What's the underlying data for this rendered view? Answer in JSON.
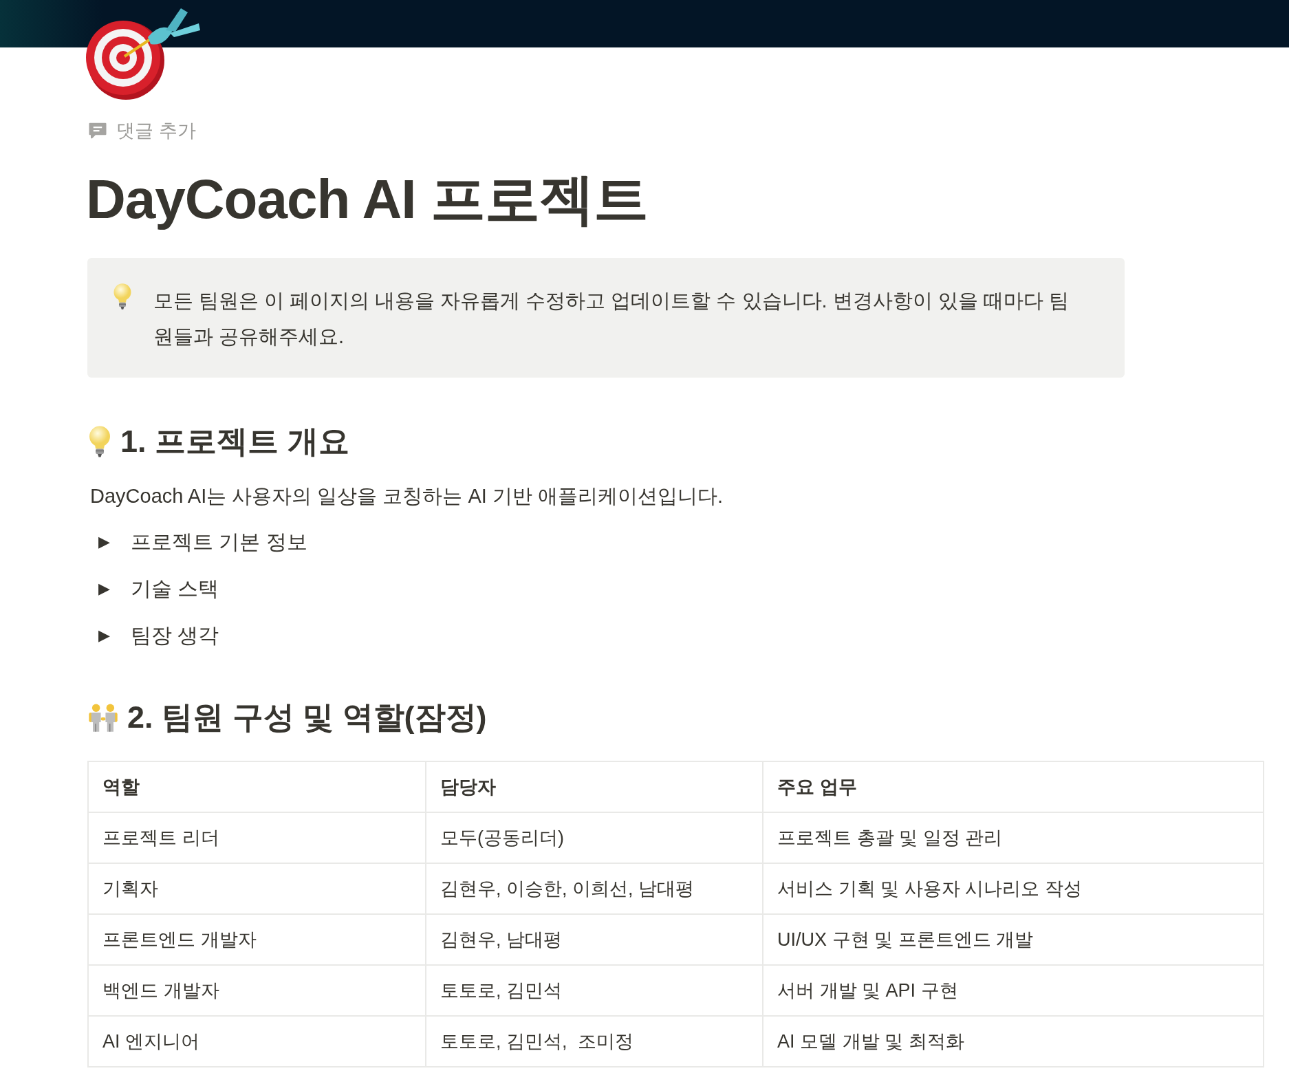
{
  "comment_button": {
    "label": "댓글 추가"
  },
  "title": "DayCoach AI 프로젝트",
  "callout": {
    "text": "모든 팀원은 이 페이지의 내용을 자유롭게 수정하고 업데이트할 수 있습니다. 변경사항이 있을 때마다 팀원들과 공유해주세요."
  },
  "sections": [
    {
      "heading": "1. 프로젝트 개요",
      "paragraph": "DayCoach AI는 사용자의 일상을 코칭하는 AI 기반 애플리케이션입니다.",
      "toggles": [
        {
          "marker": "▶",
          "label": "프로젝트 기본 정보",
          "expanded": false
        },
        {
          "marker": "▶",
          "label": "기술 스택",
          "expanded": false
        },
        {
          "marker": "▶",
          "label": "팀장 생각",
          "expanded": false
        }
      ]
    },
    {
      "heading": "2. 팀원 구성 및 역할(잠정)",
      "table": {
        "columns": [
          "역할",
          "담당자",
          "주요 업무"
        ],
        "rows": [
          [
            "프로젝트 리더",
            "모두(공동리더)",
            "프로젝트 총괄 및 일정 관리"
          ],
          [
            "기획자",
            "김현우, 이승한, 이희선, 남대평",
            "서비스 기획 및 사용자 시나리오 작성"
          ],
          [
            "프론트엔드 개발자",
            "김현우, 남대평",
            "UI/UX 구현 및 프론트엔드 개발"
          ],
          [
            "백엔드 개발자",
            "토토로, 김민석",
            "서버 개발 및 API 구현"
          ],
          [
            "AI 엔지니어",
            "토토로, 김민석,  조미정",
            "AI 모델 개발 및 최적화"
          ]
        ]
      }
    }
  ]
}
